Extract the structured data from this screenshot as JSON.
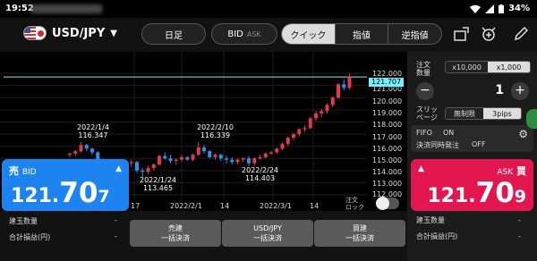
{
  "status": {
    "time": "19:52",
    "battery": "34%"
  },
  "header": {
    "pair": "USD/JPY",
    "period": "日足",
    "bid_label": "BID",
    "ask_label": "ASK",
    "modes": [
      "クイック",
      "指値",
      "逆指値"
    ]
  },
  "chart": {
    "y_labels": [
      "122.000",
      "121.000",
      "120.000",
      "119.000",
      "118.000",
      "117.000",
      "116.000",
      "115.000",
      "114.000",
      "113.000",
      "112.000"
    ],
    "x_labels": [
      "17",
      "2022/2/1",
      "14",
      "2022/3/1",
      "14"
    ],
    "current_price": "121.707",
    "annotations": [
      {
        "date": "2022/1/4",
        "value": "116.347"
      },
      {
        "date": "2022/1/24",
        "value": "113.465"
      },
      {
        "date": "2022/2/10",
        "value": "116.339"
      },
      {
        "date": "2022/2/24",
        "value": "114.403"
      }
    ],
    "lock_label": [
      "注文",
      "ロック"
    ]
  },
  "chart_data": {
    "type": "candlestick",
    "ylim": [
      112,
      122.3
    ],
    "series": [
      {
        "name": "candles",
        "values": [
          [
            115.3,
            115.5,
            115.1,
            115.4
          ],
          [
            115.4,
            115.7,
            115.2,
            115.6
          ],
          [
            115.6,
            116.35,
            115.5,
            116.1
          ],
          [
            116.1,
            116.2,
            115.6,
            115.8
          ],
          [
            115.8,
            115.9,
            115.3,
            115.5
          ],
          [
            115.5,
            115.6,
            114.6,
            114.8
          ],
          [
            114.8,
            115.0,
            114.3,
            114.5
          ],
          [
            114.5,
            114.7,
            114.1,
            114.3
          ],
          [
            114.3,
            114.6,
            114.0,
            114.2
          ],
          [
            114.2,
            114.5,
            113.9,
            114.4
          ],
          [
            114.4,
            114.8,
            114.2,
            114.6
          ],
          [
            114.6,
            114.9,
            114.3,
            114.7
          ],
          [
            114.7,
            114.8,
            113.8,
            114.0
          ],
          [
            114.0,
            114.2,
            113.47,
            113.9
          ],
          [
            113.9,
            114.4,
            113.7,
            114.2
          ],
          [
            114.2,
            114.6,
            114.0,
            114.5
          ],
          [
            114.5,
            115.3,
            114.4,
            115.2
          ],
          [
            115.2,
            115.5,
            114.9,
            115.0
          ],
          [
            115.0,
            115.3,
            114.6,
            114.8
          ],
          [
            114.8,
            115.0,
            114.5,
            114.9
          ],
          [
            114.9,
            115.3,
            114.7,
            115.1
          ],
          [
            115.1,
            115.2,
            114.8,
            114.9
          ],
          [
            114.9,
            115.4,
            114.8,
            115.3
          ],
          [
            115.3,
            116.34,
            115.2,
            115.9
          ],
          [
            115.9,
            116.1,
            115.4,
            115.6
          ],
          [
            115.6,
            115.7,
            115.0,
            115.1
          ],
          [
            115.1,
            115.4,
            114.9,
            115.3
          ],
          [
            115.3,
            115.4,
            114.8,
            115.0
          ],
          [
            115.0,
            115.2,
            114.6,
            114.9
          ],
          [
            114.9,
            115.1,
            114.5,
            114.7
          ],
          [
            114.7,
            115.0,
            114.5,
            114.9
          ],
          [
            114.9,
            115.1,
            114.7,
            115.0
          ],
          [
            115.0,
            115.2,
            114.4,
            114.6
          ],
          [
            114.6,
            115.1,
            114.4,
            115.0
          ],
          [
            115.0,
            115.3,
            114.9,
            115.1
          ],
          [
            115.1,
            115.5,
            115.0,
            115.4
          ],
          [
            115.4,
            115.6,
            115.3,
            115.5
          ],
          [
            115.5,
            115.9,
            115.4,
            115.8
          ],
          [
            115.8,
            116.3,
            115.7,
            116.2
          ],
          [
            116.2,
            116.8,
            116.0,
            116.7
          ],
          [
            116.7,
            117.1,
            116.5,
            117.0
          ],
          [
            117.0,
            117.5,
            116.8,
            117.4
          ],
          [
            117.4,
            117.7,
            117.2,
            117.5
          ],
          [
            117.5,
            118.4,
            117.4,
            118.3
          ],
          [
            118.3,
            118.9,
            118.1,
            118.7
          ],
          [
            118.7,
            119.1,
            118.4,
            118.9
          ],
          [
            118.9,
            119.5,
            118.7,
            119.4
          ],
          [
            119.4,
            120.1,
            119.2,
            120.0
          ],
          [
            120.0,
            121.2,
            119.9,
            121.1
          ],
          [
            121.1,
            121.5,
            120.6,
            120.8
          ],
          [
            120.8,
            122.0,
            120.7,
            121.7
          ]
        ]
      }
    ]
  },
  "bid": {
    "label": "売",
    "sub": "BID",
    "price_main": "121.",
    "price_big": "70",
    "price_last": "7"
  },
  "ask": {
    "label": "買",
    "sub": "ASK",
    "price_main": "121.",
    "price_big": "70",
    "price_last": "9"
  },
  "bottom": {
    "stat1": "建玉数量",
    "stat2": "合計損益(円)",
    "dash": "-",
    "btn_sell": [
      "売建",
      "一括決済"
    ],
    "btn_pair": [
      "USD/JPY",
      "一括決済"
    ],
    "btn_buy": [
      "買建",
      "一括決済"
    ]
  },
  "panel": {
    "order_qty_label": [
      "注文",
      "数量"
    ],
    "qty_options": [
      "x10,000",
      "x1,000"
    ],
    "qty_value": "1",
    "slippage_label": [
      "スリッ",
      "ページ"
    ],
    "slip_options": [
      "無制限",
      "3pips"
    ],
    "fifo": "FIFO",
    "fifo_state": "ON",
    "settle": "決済同時発注",
    "settle_state": "OFF",
    "stat1": "建玉数量",
    "stat2": "合計損益(円)",
    "dash": "-"
  }
}
